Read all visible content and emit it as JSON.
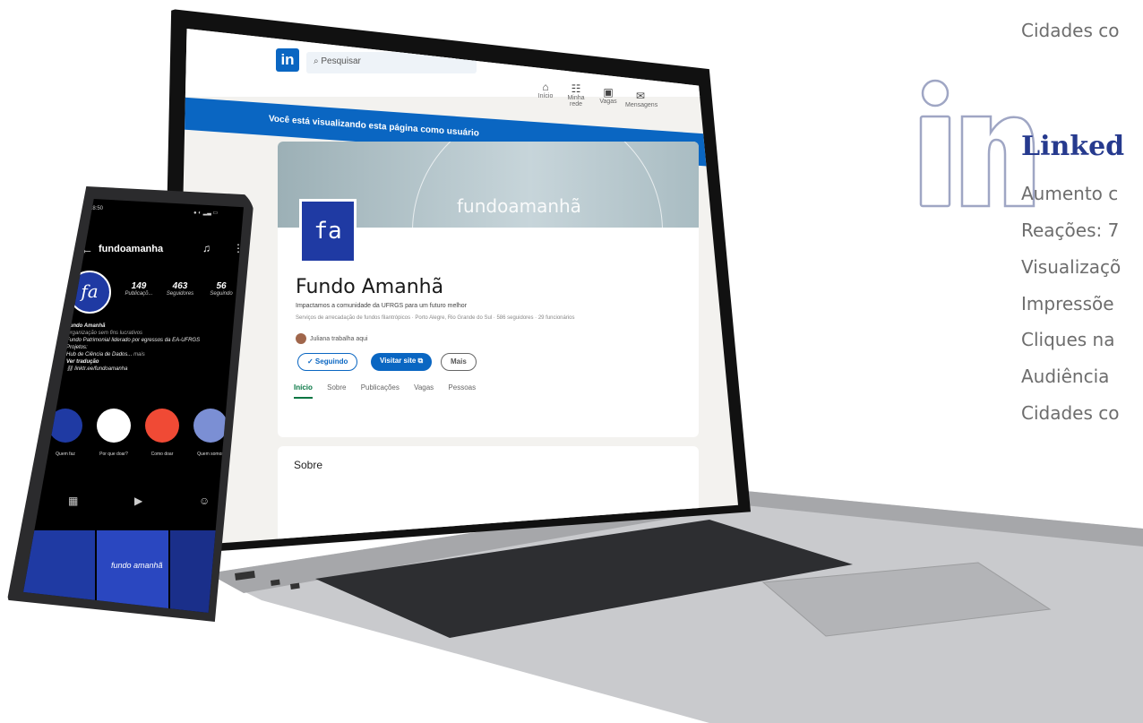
{
  "right_panel": {
    "top_line": "Cidades co",
    "heading": "Linked",
    "lines": [
      "Aumento c",
      "Reações: 7",
      "Visualizaçõ",
      "Impressõe",
      "Cliques na",
      "Audiência",
      "Cidades co"
    ],
    "accent_color": "#263a8e"
  },
  "linkedin": {
    "logo": "in",
    "search_placeholder": "Pesquisar",
    "banner": "Você está visualizando esta página como usuário",
    "nav": [
      {
        "icon": "home-icon",
        "label": "Início"
      },
      {
        "icon": "network-icon",
        "label": "Minha rede"
      },
      {
        "icon": "jobs-icon",
        "label": "Vagas"
      },
      {
        "icon": "messaging-icon",
        "label": "Mensagens"
      }
    ],
    "cover_text": "fundoamanhã",
    "avatar_text": "fa",
    "company_name": "Fundo Amanhã",
    "tagline": "Impactamos a comunidade da UFRGS para um futuro melhor",
    "meta": "Serviços de arrecadação de fundos filantrópicos · Porto Alegre, Rio Grande do Sul · 586 seguidores · 29 funcionários",
    "works_here": "Juliana trabalha aqui",
    "buttons": {
      "follow": "✓ Seguindo",
      "site": "Visitar site ⧉",
      "more": "Mais"
    },
    "tabs": [
      "Início",
      "Sobre",
      "Publicações",
      "Vagas",
      "Pessoas"
    ],
    "about_title": "Sobre",
    "brand_color": "#0a66c2"
  },
  "instagram": {
    "time": "18:50",
    "username": "fundoamanha",
    "avatar_text": "fa",
    "stats": [
      {
        "num": "149",
        "label": "Publicaçõ..."
      },
      {
        "num": "463",
        "label": "Seguidores"
      },
      {
        "num": "56",
        "label": "Seguindo"
      }
    ],
    "bio": {
      "name": "Fundo Amanhã",
      "category": "Organização sem fins lucrativos",
      "line1": "Fundo Patrimonial liderado por egressos da EA-UFRGS",
      "line2": "Projetos:",
      "line3": "Hub de Ciência de Dados...",
      "more": "mais",
      "translate": "Ver tradução",
      "link": "linktr.ee/fundoamanha"
    },
    "highlights": [
      {
        "label": "Quem faz",
        "color": "#1f3aa3"
      },
      {
        "label": "Por que doar?",
        "color": "#ffffff"
      },
      {
        "label": "Como doar",
        "color": "#f04a35"
      },
      {
        "label": "Quem somos",
        "color": "#7b8fd4"
      }
    ],
    "grid_tile_text": "fundo amanhã"
  }
}
